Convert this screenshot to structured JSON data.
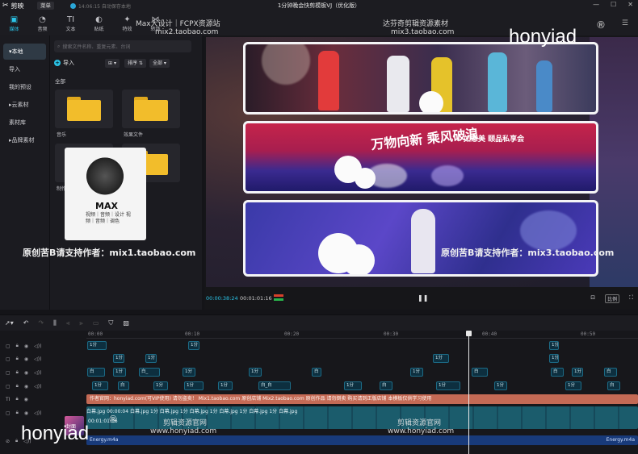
{
  "app": {
    "name": "剪映",
    "menu_label": "菜单",
    "autosave": "14:06:15 自动保存本地",
    "project_title": "1分钟晚会快剪模板VJ（优化版）"
  },
  "toolbar": {
    "tabs": [
      {
        "label": "媒体",
        "icon": "media-icon"
      },
      {
        "label": "音频",
        "icon": "audio-icon"
      },
      {
        "label": "文本",
        "icon": "text-icon"
      },
      {
        "label": "贴纸",
        "icon": "sticker-icon"
      },
      {
        "label": "特效",
        "icon": "effects-icon"
      },
      {
        "label": "转场",
        "icon": "transition-icon"
      }
    ]
  },
  "sidebar": {
    "items": [
      {
        "label": "▾本地",
        "active": true
      },
      {
        "label": "导入"
      },
      {
        "label": "我的预设"
      },
      {
        "label": "▸云素材"
      },
      {
        "label": "素材库"
      },
      {
        "label": "▸品牌素材"
      }
    ]
  },
  "media": {
    "search_placeholder": "搜索文件名称、重复元素、台词",
    "import_label": "导入",
    "view_label": "⊞ ▾",
    "sort_label": "排序 ⇅",
    "filter_label": "全部 ▾",
    "all_label": "全部",
    "folders": [
      {
        "label": "音乐"
      },
      {
        "label": "效果文件"
      },
      {
        "label": "制作..."
      },
      {
        "label": ""
      }
    ]
  },
  "player": {
    "current_time": "00:00:38:24",
    "total_time": "00:01:01:16",
    "ratio_label": "比例",
    "banner_text": "万物向新 乘风破浪",
    "banner_sub": "如意美 颐品私享会"
  },
  "timeline": {
    "ruler_labels": [
      "00:00",
      "00:10",
      "00:20",
      "00:30",
      "00:40",
      "00:50"
    ],
    "text_track": "作者官网：honyiad.com(可VIP使用)  请勿盗卖！  Mix1.taobao.com  原创店铺  Mix2.taobao.com  原创作品  请勿倒卖  购买请到正版店铺  本模板仅供学习使用",
    "main_clip_label": "白幕.jpg  00:00:04  白幕.jpg  1分  白幕.jpg  1分  白幕.jpg  1分  白幕.jpg  1分  白幕.jpg  1分  白幕.jpg",
    "cover_label": "封面",
    "main_time": "00:01:01:16",
    "audio_left": "Energy.m4a",
    "audio_right": "Energy.m4a",
    "clip_labels": [
      "1分",
      "1分",
      "白",
      "白",
      "1分",
      "白_",
      "1分",
      "白",
      "白",
      "白",
      "1分",
      "白_白"
    ]
  },
  "watermarks": {
    "top_left": "Max大设计｜FCPX资源站",
    "top_left_url": "mix2.taobao.com",
    "top_center": "达芬奇剪辑资源素材",
    "top_center_url": "mix3.taobao.com",
    "brand_top": "honyiad",
    "brand_bottom": "honyiad",
    "line_left": "原创苦B请支持作者：mix1.taobao.com",
    "line_right": "原创苦B请支持作者：mix3.taobao.com",
    "site_left": "剪辑资源官网",
    "site_left_url": "www.honyiad.com",
    "site_right": "剪辑资源官网",
    "site_right_url": "www.honyiad.com",
    "card_title": "MAX",
    "card_sub": "视频｜音频｜设计 视频｜音频｜调色"
  },
  "colors": {
    "accent": "#2bc4e8",
    "text_track": "#c46a55",
    "audio_track": "#183a7a",
    "folder": "#f2bd2b"
  }
}
